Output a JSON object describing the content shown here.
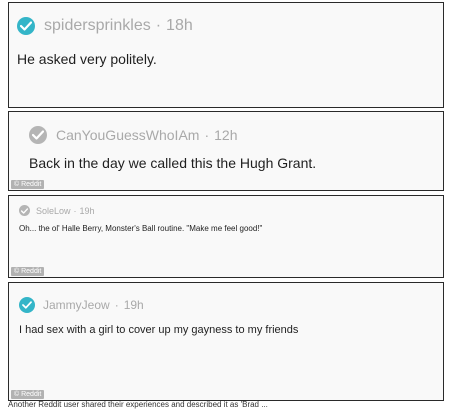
{
  "colors": {
    "check_active": "#34b5c8",
    "check_inactive": "#b5b5b5",
    "meta_text": "#a9a9a9",
    "body_text": "#1f1f1f"
  },
  "watermark_label": "© Reddit",
  "comments": [
    {
      "username": "spidersprinkles",
      "separator": "·",
      "time": "18h",
      "text": "He asked very politely.",
      "check_icon": "check-circle-icon",
      "check_state": "active"
    },
    {
      "username": "CanYouGuessWhoIAm",
      "separator": "·",
      "time": "12h",
      "text": "Back in the day we called this the Hugh Grant.",
      "check_icon": "check-circle-icon",
      "check_state": "inactive"
    },
    {
      "username": "SoleLow",
      "separator": "·",
      "time": "19h",
      "text": "Oh... the ol' Halle Berry, Monster's Ball routine. \"Make me feel good!\"",
      "check_icon": "check-circle-icon",
      "check_state": "inactive"
    },
    {
      "username": "JammyJeow",
      "separator": "·",
      "time": "19h",
      "text": "I had sex with a girl to cover up my gayness to my friends",
      "check_icon": "check-circle-icon",
      "check_state": "active"
    }
  ],
  "caption": "Another Reddit user shared their experiences and described it as 'Brad ..."
}
